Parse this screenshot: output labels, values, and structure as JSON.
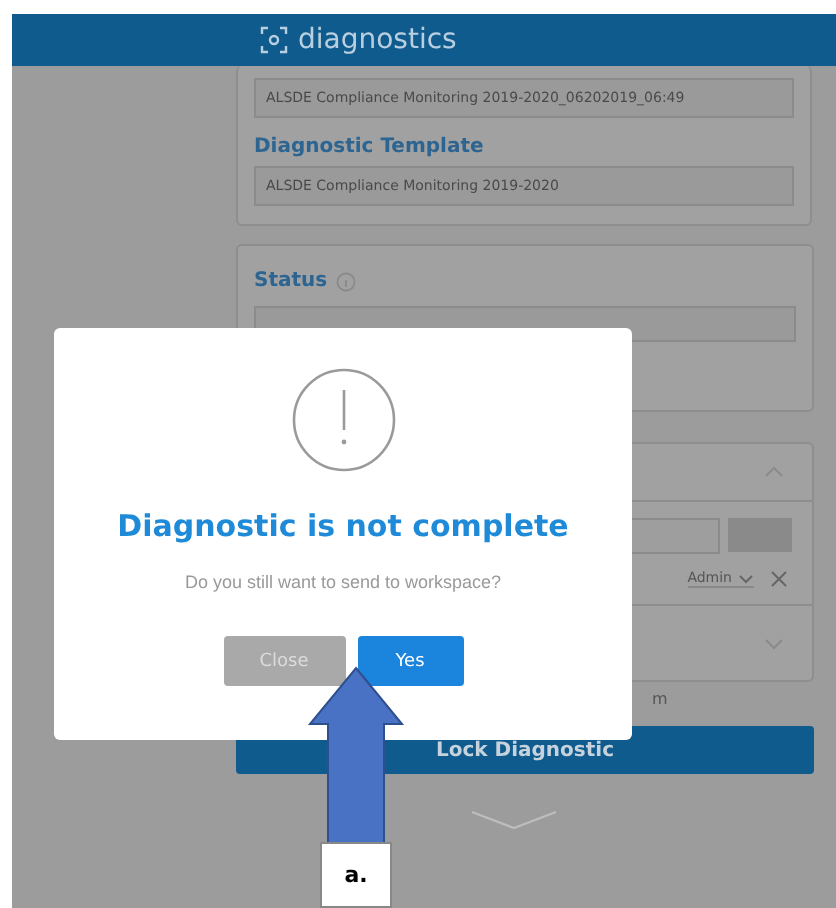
{
  "header": {
    "title": "diagnostics"
  },
  "details": {
    "name_value": "ALSDE Compliance Monitoring 2019-2020_06202019_06:49",
    "template_label": "Diagnostic Template",
    "template_value": "ALSDE Compliance Monitoring 2019-2020"
  },
  "status": {
    "label": "Status"
  },
  "access_panel": {
    "role": "Admin"
  },
  "partial_text": "m",
  "lock_button": "Lock Diagnostic",
  "dialog": {
    "title": "Diagnostic is not complete",
    "message": "Do you still want to send to workspace?",
    "buttons": [
      {
        "label": "Close",
        "kind": "secondary"
      },
      {
        "label": "Yes",
        "kind": "primary"
      }
    ]
  },
  "annotation": {
    "label": "a."
  }
}
